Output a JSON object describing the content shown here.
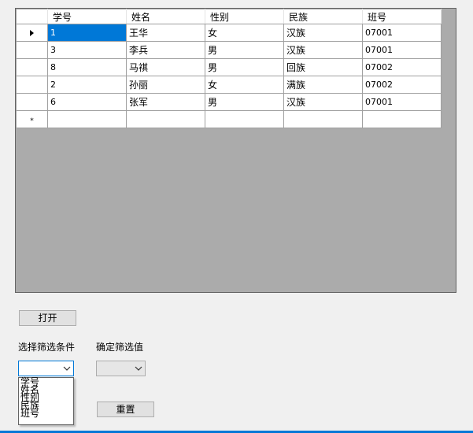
{
  "grid": {
    "columns": [
      "学号",
      "姓名",
      "性别",
      "民族",
      "班号"
    ],
    "rows": [
      {
        "id": "1",
        "name": "王华",
        "gender": "女",
        "ethnicity": "汉族",
        "class": "07001"
      },
      {
        "id": "3",
        "name": "李兵",
        "gender": "男",
        "ethnicity": "汉族",
        "class": "07001"
      },
      {
        "id": "8",
        "name": "马祺",
        "gender": "男",
        "ethnicity": "回族",
        "class": "07002"
      },
      {
        "id": "2",
        "name": "孙丽",
        "gender": "女",
        "ethnicity": "满族",
        "class": "07002"
      },
      {
        "id": "6",
        "name": "张军",
        "gender": "男",
        "ethnicity": "汉族",
        "class": "07001"
      }
    ],
    "new_row_marker": "*"
  },
  "open_button": "打开",
  "filter_condition_label": "选择筛选条件",
  "filter_value_label": "确定筛选值",
  "filter_condition_options": [
    "学号",
    "姓名",
    "性别",
    "民族",
    "班号"
  ],
  "reset_button": "重置",
  "accent_color": "#0078d7"
}
